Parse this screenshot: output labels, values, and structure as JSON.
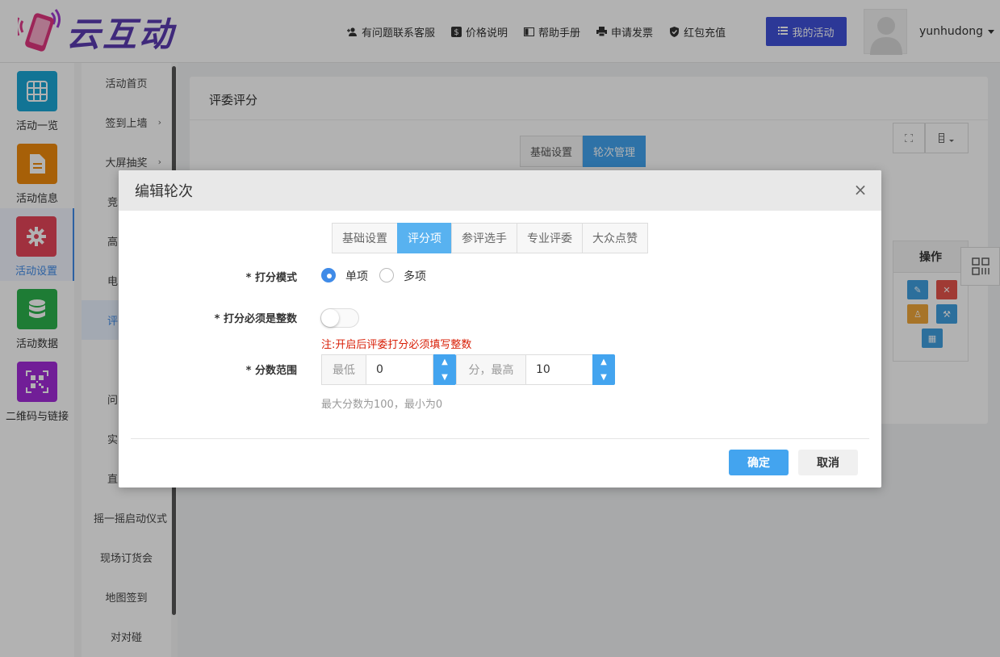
{
  "header": {
    "logo_text": "云互动",
    "nav": [
      {
        "label": "有问题联系客服",
        "icon": "user-plus-icon"
      },
      {
        "label": "价格说明",
        "icon": "dollar-icon"
      },
      {
        "label": "帮助手册",
        "icon": "book-icon"
      },
      {
        "label": "申请发票",
        "icon": "printer-icon"
      },
      {
        "label": "红包充值",
        "icon": "shield-check-icon"
      }
    ],
    "my_activity": "我的活动",
    "username": "yunhudong"
  },
  "iconbar": [
    {
      "label": "活动一览",
      "icon": "grid-icon",
      "color": "#1aa6d6"
    },
    {
      "label": "活动信息",
      "icon": "document-icon",
      "color": "#f08a0c"
    },
    {
      "label": "活动设置",
      "icon": "gear-icon",
      "color": "#e6455a"
    },
    {
      "label": "活动数据",
      "icon": "database-icon",
      "color": "#2bb24c"
    },
    {
      "label": "二维码与链接",
      "icon": "qrcode-icon",
      "color": "#a32bd9"
    }
  ],
  "subbar": [
    {
      "label": "活动首页"
    },
    {
      "label": "签到上墙",
      "chevron": "›"
    },
    {
      "label": "大屏抽奖",
      "chevron": "›"
    },
    {
      "label": "竞"
    },
    {
      "label": "高"
    },
    {
      "label": "电"
    },
    {
      "label": "评"
    },
    {
      "label": "问"
    },
    {
      "label": "实"
    },
    {
      "label": "直"
    },
    {
      "label": "摇一摇启动仪式"
    },
    {
      "label": "现场订货会"
    },
    {
      "label": "地图签到"
    },
    {
      "label": "对对碰"
    }
  ],
  "panel": {
    "title": "评委评分",
    "tabs": [
      "基础设置",
      "轮次管理"
    ],
    "op_header": "操作"
  },
  "modal": {
    "title": "编辑轮次",
    "close": "×",
    "tabs": [
      "基础设置",
      "评分项",
      "参评选手",
      "专业评委",
      "大众点赞"
    ],
    "score_mode_label": "* 打分模式",
    "score_mode_options": [
      "单项",
      "多项"
    ],
    "integer_label": "* 打分必须是整数",
    "integer_warning": "注:开启后评委打分必须填写整数",
    "range_label": "* 分数范围",
    "min_addon": "最低",
    "min_value": "0",
    "mid_addon": "分，最高",
    "max_value": "10",
    "hint": "最大分数为100，最小为0",
    "ok": "确定",
    "cancel": "取消"
  }
}
